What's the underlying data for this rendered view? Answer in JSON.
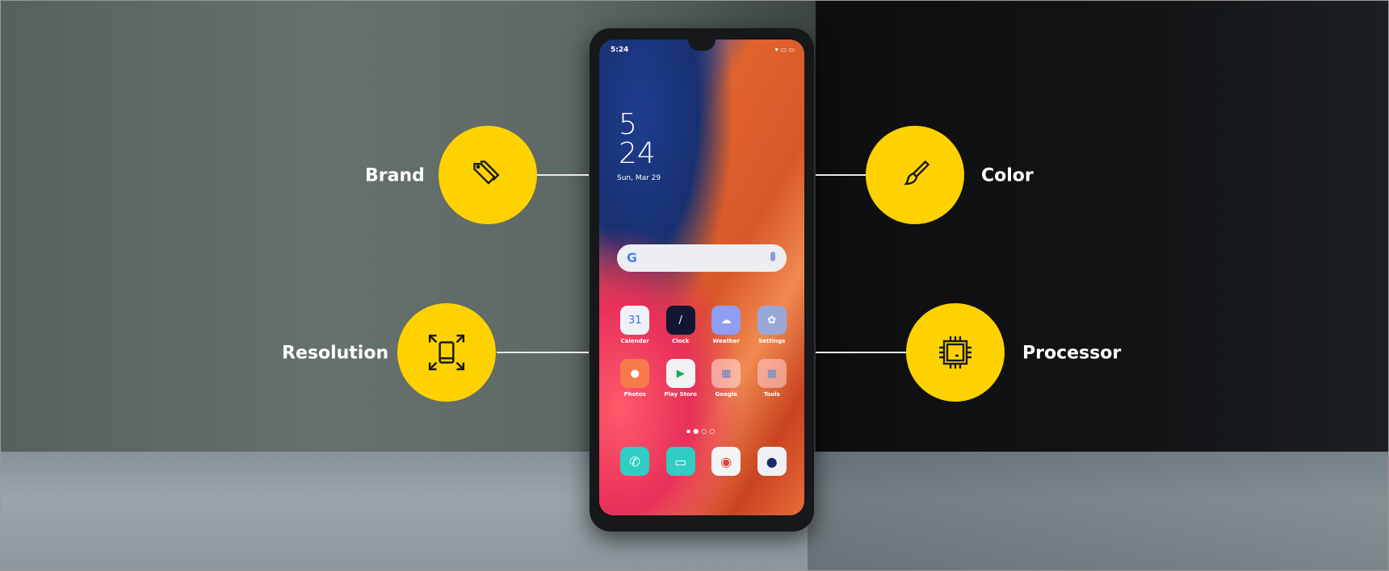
{
  "colors": {
    "accent": "#fed200",
    "icon_stroke": "#1a1a1a"
  },
  "features": {
    "brand": {
      "label": "Brand",
      "icon": "price-tag-icon"
    },
    "color": {
      "label": "Color",
      "icon": "paintbrush-icon"
    },
    "resolution": {
      "label": "Resolution",
      "icon": "screen-expand-icon"
    },
    "processor": {
      "label": "Processor",
      "icon": "cpu-chip-icon"
    }
  },
  "phone": {
    "status_time": "5:24",
    "status_icons": "wifi battery",
    "clock_hour": "5",
    "clock_minute": "24",
    "date": "Sun, Mar 29",
    "search_logo": "G",
    "apps": [
      {
        "label": "Calendar",
        "glyph": "31"
      },
      {
        "label": "Clock",
        "glyph": "/"
      },
      {
        "label": "Weather",
        "glyph": "☁"
      },
      {
        "label": "Settings",
        "glyph": "✿"
      },
      {
        "label": "Photos",
        "glyph": "●"
      },
      {
        "label": "Play Store",
        "glyph": "▶"
      },
      {
        "label": "Google",
        "glyph": "▦"
      },
      {
        "label": "Tools",
        "glyph": "▦"
      }
    ],
    "page_indicator": "▪●○○",
    "dock": [
      {
        "name": "phone",
        "glyph": "✆"
      },
      {
        "name": "messages",
        "glyph": "▭"
      },
      {
        "name": "chrome",
        "glyph": "◉"
      },
      {
        "name": "camera",
        "glyph": "●"
      }
    ]
  }
}
